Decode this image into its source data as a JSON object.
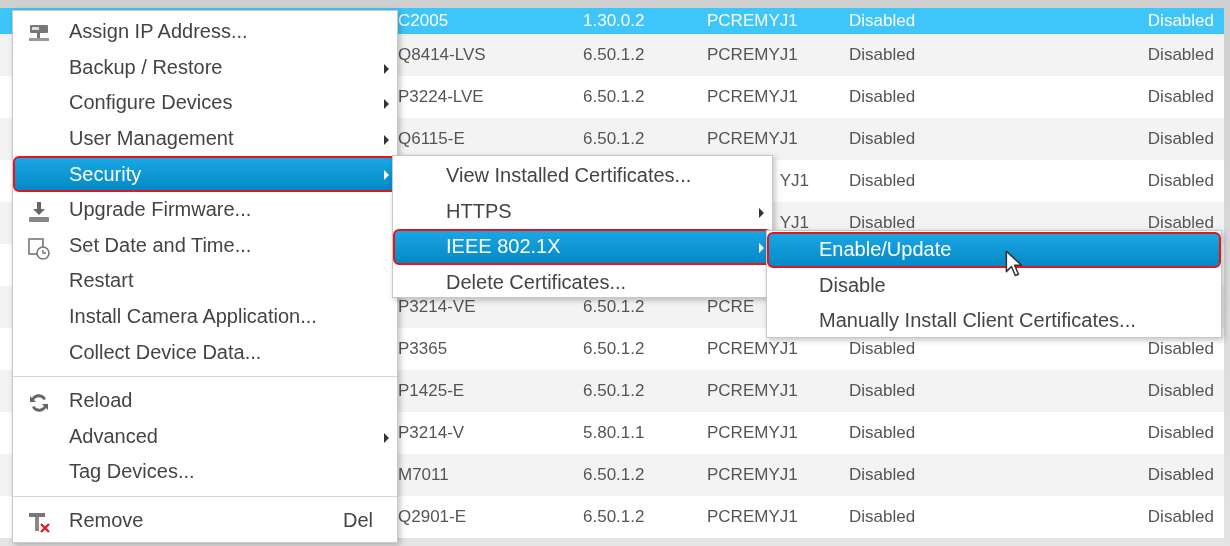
{
  "table": {
    "rows": [
      {
        "kind": "device",
        "selected": true,
        "model": "C2005",
        "firmware": "1.30.0.2",
        "host": "PCREMYJ1",
        "column_4": "Disabled",
        "column_5": "Disabled"
      },
      {
        "kind": "device",
        "selected": false,
        "model": "Q8414-LVS",
        "firmware": "6.50.1.2",
        "host": "PCREMYJ1",
        "column_4": "Disabled",
        "column_5": "Disabled"
      },
      {
        "kind": "device",
        "selected": false,
        "model": "P3224-LVE",
        "firmware": "6.50.1.2",
        "host": "PCREMYJ1",
        "column_4": "Disabled",
        "column_5": "Disabled"
      },
      {
        "kind": "device",
        "selected": false,
        "model": "Q6115-E",
        "firmware": "6.50.1.2",
        "host": "PCREMYJ1",
        "column_4": "Disabled",
        "column_5": "Disabled"
      },
      {
        "kind": "device",
        "selected": false,
        "host_tail": "YJ1",
        "column_4": "Disabled",
        "column_5": "Disabled"
      },
      {
        "kind": "device",
        "selected": false,
        "host_tail": "YJ1",
        "column_4": "Disabled",
        "column_5": "Disabled"
      },
      {
        "kind": "covered"
      },
      {
        "kind": "device",
        "selected": false,
        "model": "P3214-VE",
        "firmware": "6.50.1.2",
        "host": "PCRE"
      },
      {
        "kind": "device",
        "selected": false,
        "model": "P3365",
        "firmware": "6.50.1.2",
        "host": "PCREMYJ1",
        "column_4": "Disabled",
        "column_5": "Disabled"
      },
      {
        "kind": "device",
        "selected": false,
        "model": "P1425-E",
        "firmware": "6.50.1.2",
        "host": "PCREMYJ1",
        "column_4": "Disabled",
        "column_5": "Disabled"
      },
      {
        "kind": "device",
        "selected": false,
        "model": "P3214-V",
        "firmware": "5.80.1.1",
        "host": "PCREMYJ1",
        "column_4": "Disabled",
        "column_5": "Disabled"
      },
      {
        "kind": "device",
        "selected": false,
        "model": "M7011",
        "firmware": "6.50.1.2",
        "host": "PCREMYJ1",
        "column_4": "Disabled",
        "column_5": "Disabled"
      },
      {
        "kind": "device",
        "selected": false,
        "model": "Q2901-E",
        "firmware": "6.50.1.2",
        "host": "PCREMYJ1",
        "column_4": "Disabled",
        "column_5": "Disabled"
      }
    ]
  },
  "context_menu": {
    "items": [
      {
        "kind": "item",
        "label": "Assign IP Address...",
        "selected": false,
        "submenu": false
      },
      {
        "kind": "item",
        "label": "Backup / Restore",
        "selected": false,
        "submenu": true
      },
      {
        "kind": "item",
        "label": "Configure Devices",
        "selected": false,
        "submenu": true
      },
      {
        "kind": "item",
        "label": "User Management",
        "selected": false,
        "submenu": true
      },
      {
        "kind": "item",
        "label": "Security",
        "selected": true,
        "submenu": true
      },
      {
        "kind": "item",
        "label": "Upgrade Firmware...",
        "selected": false,
        "submenu": false
      },
      {
        "kind": "item",
        "label": "Set Date and Time...",
        "selected": false,
        "submenu": false
      },
      {
        "kind": "item",
        "label": "Restart",
        "selected": false,
        "submenu": false
      },
      {
        "kind": "item",
        "label": "Install Camera Application...",
        "selected": false,
        "submenu": false
      },
      {
        "kind": "item",
        "label": "Collect Device Data...",
        "selected": false,
        "submenu": false
      },
      {
        "kind": "separator"
      },
      {
        "kind": "item",
        "label": "Reload",
        "selected": false,
        "submenu": false
      },
      {
        "kind": "item",
        "label": "Advanced",
        "selected": false,
        "submenu": true
      },
      {
        "kind": "item",
        "label": "Tag Devices...",
        "selected": false,
        "submenu": false
      },
      {
        "kind": "separator"
      },
      {
        "kind": "item",
        "label": "Remove",
        "selected": false,
        "submenu": false,
        "shortcut": "Del"
      }
    ]
  },
  "security_submenu": {
    "items": [
      {
        "kind": "item",
        "label": "View Installed Certificates...",
        "selected": false,
        "submenu": false
      },
      {
        "kind": "item",
        "label": "HTTPS",
        "selected": false,
        "submenu": true
      },
      {
        "kind": "item",
        "label": "IEEE 802.1X",
        "selected": true,
        "submenu": true
      },
      {
        "kind": "item",
        "label": "Delete Certificates...",
        "selected": false,
        "submenu": false
      }
    ]
  },
  "ieee_submenu": {
    "items": [
      {
        "kind": "item",
        "label": "Enable/Update",
        "selected": true,
        "submenu": false
      },
      {
        "kind": "item",
        "label": "Disable",
        "selected": false,
        "submenu": false
      },
      {
        "kind": "item",
        "label": "Manually Install Client Certificates...",
        "selected": false,
        "submenu": false
      }
    ]
  }
}
